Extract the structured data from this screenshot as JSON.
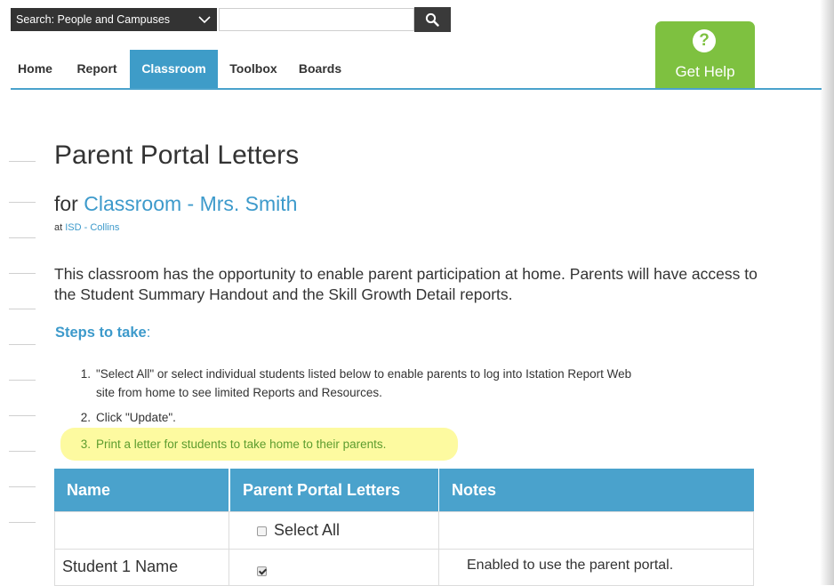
{
  "search": {
    "scope_label": "Search: People and Campuses",
    "query_value": "",
    "query_placeholder": ""
  },
  "nav": {
    "items": [
      {
        "label": "Home",
        "active": false
      },
      {
        "label": "Report",
        "active": false
      },
      {
        "label": "Classroom",
        "active": true
      },
      {
        "label": "Toolbox",
        "active": false
      },
      {
        "label": "Boards",
        "active": false
      }
    ]
  },
  "help": {
    "icon": "?",
    "label": "Get Help"
  },
  "page": {
    "title": "Parent Portal Letters",
    "for_prefix": "for",
    "classroom_link": "Classroom - Mrs. Smith",
    "at_prefix": "at",
    "school_link": "ISD - Collins",
    "description": "This classroom has the opportunity to enable parent participation at home. Parents will have access to the Student Summary Handout and the Skill Growth Detail reports.",
    "steps_heading": "Steps to take",
    "steps_colon": ":",
    "steps": [
      {
        "num": "1.",
        "line1": "\"Select All\" or select individual students listed below to enable parents to log into Istation Report Web",
        "line2": "site from home to see limited Reports and Resources."
      },
      {
        "num": "2.",
        "line1": "Click \"Update\"."
      },
      {
        "num": "3.",
        "line1": "Print a letter for students to take home to their parents."
      }
    ]
  },
  "table": {
    "headers": [
      "Name",
      "Parent Portal Letters",
      "Notes"
    ],
    "select_all_label": "Select All",
    "select_all_checked": false,
    "rows": [
      {
        "name": "Student 1 Name",
        "checked": true,
        "note": "Enabled to use the parent portal."
      }
    ]
  },
  "colors": {
    "nav_active": "#3e9cc8",
    "link": "#3d9acb",
    "help_green": "#7ec140",
    "table_header": "#4aa2cc",
    "highlight": "#fdfaa0",
    "highlight_text": "#5d9c2e"
  }
}
